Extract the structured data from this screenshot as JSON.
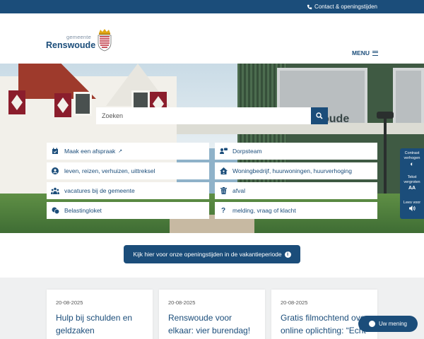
{
  "topbar": {
    "contact_label": "Contact & openingstijden"
  },
  "header": {
    "logo_sub": "gemeente",
    "logo_name": "Renswoude",
    "menu_label": "MENU"
  },
  "hero": {
    "building_sign": "oude",
    "search": {
      "placeholder": "Zoeken"
    },
    "links": [
      {
        "label": "Maak een afspraak",
        "icon": "calendar-check-icon",
        "external": true
      },
      {
        "label": "Dorpsteam",
        "icon": "people-chat-icon"
      },
      {
        "label": "leven, reizen, verhuizen, uittreksel",
        "icon": "user-circle-icon"
      },
      {
        "label": "Woningbedrijf, huurwoningen, huurverhoging",
        "icon": "house-user-icon"
      },
      {
        "label": "vacatures bij de gemeente",
        "icon": "people-group-icon"
      },
      {
        "label": "afval",
        "icon": "trash-icon"
      },
      {
        "label": "Belastingloket",
        "icon": "coins-icon"
      },
      {
        "label": "melding, vraag of klacht",
        "icon": "question-icon"
      }
    ]
  },
  "a11y": {
    "contrast_label": "Contrast verhogen",
    "text_label": "Tekst vergroten",
    "text_glyph": "AA",
    "read_label": "Lees voor"
  },
  "notice": {
    "label": "Kijk hier voor onze openingstijden in de vakantieperiode"
  },
  "news": [
    {
      "date": "20-08-2025",
      "title": "Hulp bij schulden en geldzaken"
    },
    {
      "date": "20-08-2025",
      "title": "Renswoude voor elkaar: vier burendag!"
    },
    {
      "date": "20-08-2025",
      "title": "Gratis filmochtend over online oplichting: “Echt of Nep?”"
    }
  ],
  "feedback": {
    "label": "Uw mening"
  },
  "colors": {
    "brand": "#1b4d7a",
    "news_bg": "#eff0f1",
    "crest_red": "#b8202e"
  }
}
